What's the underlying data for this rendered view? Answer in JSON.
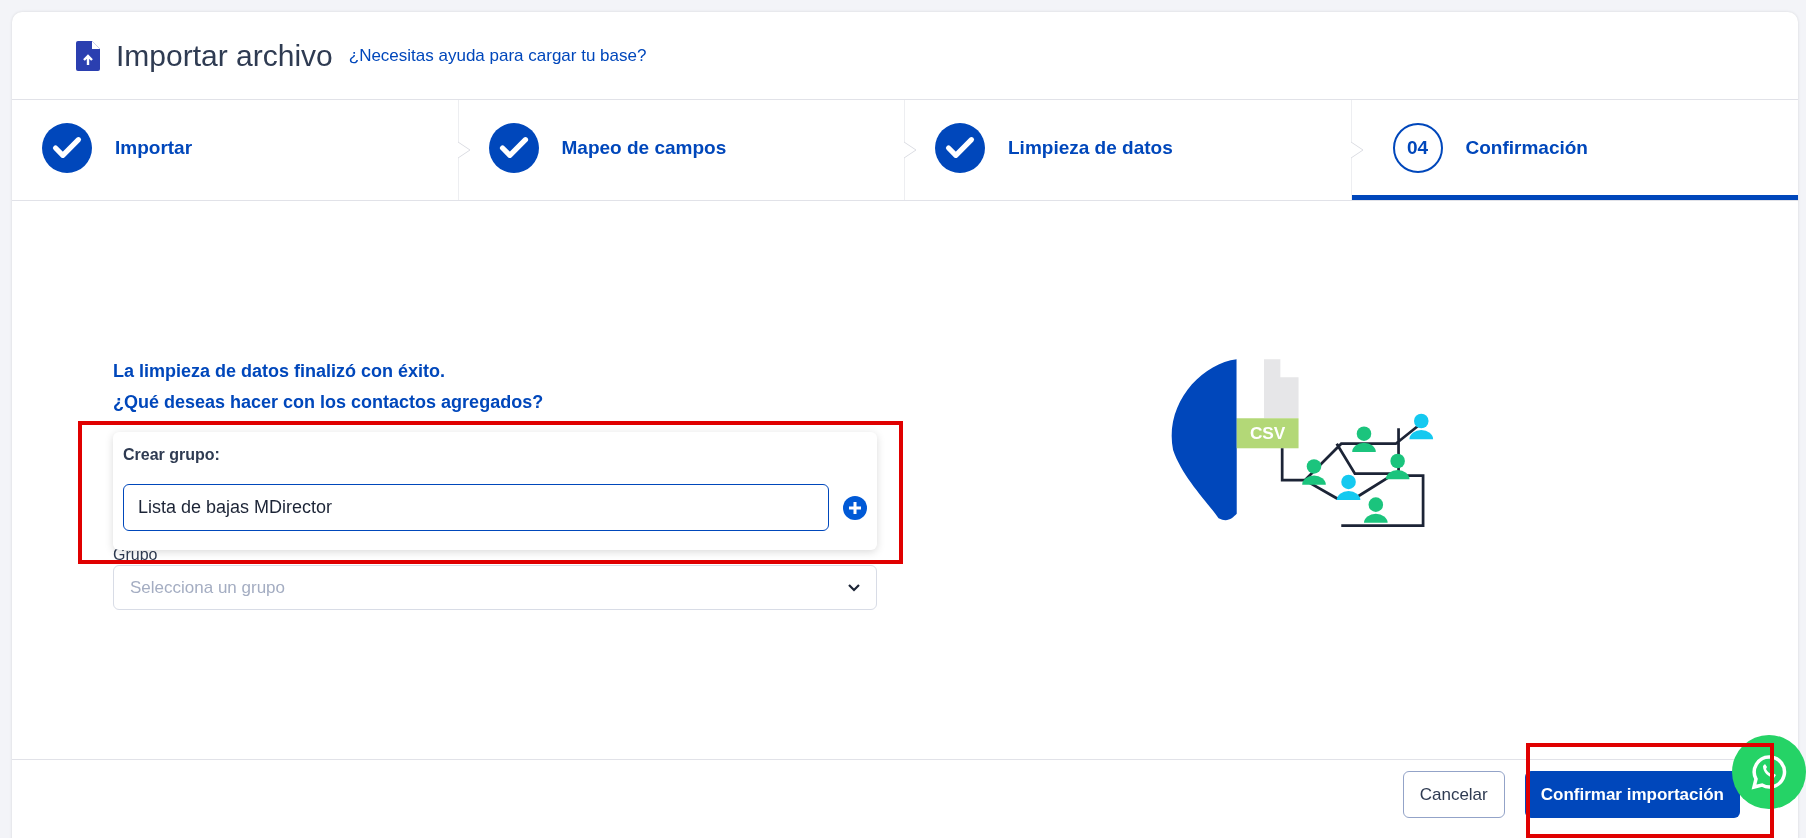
{
  "header": {
    "title": "Importar archivo",
    "help_link": "¿Necesitas ayuda para cargar tu base?"
  },
  "steps": [
    {
      "label": "Importar",
      "completed": true,
      "selected": false
    },
    {
      "label": "Mapeo de campos",
      "completed": true,
      "selected": false
    },
    {
      "label": "Limpieza de datos",
      "completed": true,
      "selected": false
    },
    {
      "label": "Confirmación",
      "number": "04",
      "completed": false,
      "selected": true
    }
  ],
  "message": [
    "La limpieza de datos finalizó con éxito.",
    "¿Qué deseas hacer con los contactos agregados?"
  ],
  "create_group": {
    "label": "Crear grupo:",
    "value": "Lista de bajas MDirector"
  },
  "group_select": {
    "label": "Grupo",
    "placeholder": "Selecciona un grupo"
  },
  "illustration": {
    "file_label": "CSV"
  },
  "buttons": [
    {
      "label": "Cancelar",
      "kind": "secondary"
    },
    {
      "label": "Confirmar importación",
      "kind": "primary"
    }
  ],
  "highlights": [
    {
      "kind": "outline"
    },
    {
      "kind": "outline"
    }
  ]
}
